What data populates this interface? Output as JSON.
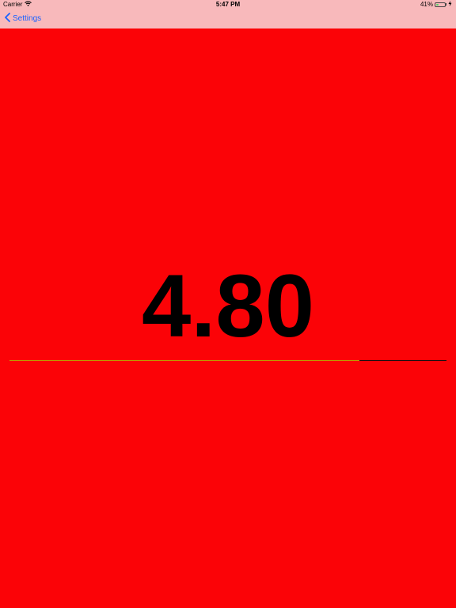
{
  "status_bar": {
    "carrier": "Carrier",
    "time": "5:47 PM",
    "battery_percent_label": "41%",
    "battery_level": 0.41,
    "wifi_icon": "wifi-icon",
    "charging_icon": "bolt-icon"
  },
  "nav": {
    "back_label": "Settings",
    "back_icon": "chevron-left-icon"
  },
  "main": {
    "value": "4.80",
    "progress_fraction": 0.8
  },
  "colors": {
    "background": "#fb0307",
    "topbar": "#f8b9bb",
    "accent": "#1a62ff",
    "progress_fill": "#b8a000",
    "progress_track": "#111111"
  }
}
